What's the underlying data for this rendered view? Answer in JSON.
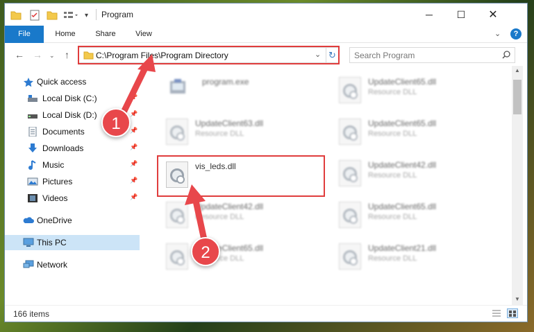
{
  "window": {
    "title": "Program"
  },
  "ribbon": {
    "tabs": [
      "File",
      "Home",
      "Share",
      "View"
    ]
  },
  "address": {
    "path": "C:\\Program Files\\Program Directory"
  },
  "search": {
    "placeholder": "Search Program"
  },
  "sidebar": {
    "items": [
      {
        "label": "Quick access",
        "icon": "star-icon"
      },
      {
        "label": "Local Disk (C:)",
        "icon": "drive-icon"
      },
      {
        "label": "Local Disk (D:)",
        "icon": "drive-icon"
      },
      {
        "label": "Documents",
        "icon": "documents-icon"
      },
      {
        "label": "Downloads",
        "icon": "download-icon"
      },
      {
        "label": "Music",
        "icon": "music-icon"
      },
      {
        "label": "Pictures",
        "icon": "pictures-icon"
      },
      {
        "label": "Videos",
        "icon": "videos-icon"
      },
      {
        "label": "OneDrive",
        "icon": "cloud-icon"
      },
      {
        "label": "This PC",
        "icon": "computer-icon"
      },
      {
        "label": "Network",
        "icon": "network-icon"
      }
    ]
  },
  "files": [
    {
      "name": "program.exe",
      "desc": ""
    },
    {
      "name": "UpdateClient65.dll",
      "desc": "Resource DLL"
    },
    {
      "name": "UpdateClient63.dll",
      "desc": "Resource DLL"
    },
    {
      "name": "UpdateClient65.dll",
      "desc": "Resource DLL"
    },
    {
      "name": "vis_leds.dll",
      "desc": ""
    },
    {
      "name": "UpdateClient42.dll",
      "desc": "Resource DLL"
    },
    {
      "name": "UpdateClient42.dll",
      "desc": "Resource DLL"
    },
    {
      "name": "UpdateClient65.dll",
      "desc": "Resource DLL"
    },
    {
      "name": "UpdateClient65.dll",
      "desc": "Resource DLL"
    },
    {
      "name": "UpdateClient21.dll",
      "desc": "Resource DLL"
    }
  ],
  "status": {
    "count": "166 items"
  },
  "callouts": {
    "one": "1",
    "two": "2"
  },
  "colors": {
    "accent": "#1979ca",
    "callout": "#e8474b",
    "highlight": "#e03c3c",
    "selected": "#cce4f7"
  }
}
